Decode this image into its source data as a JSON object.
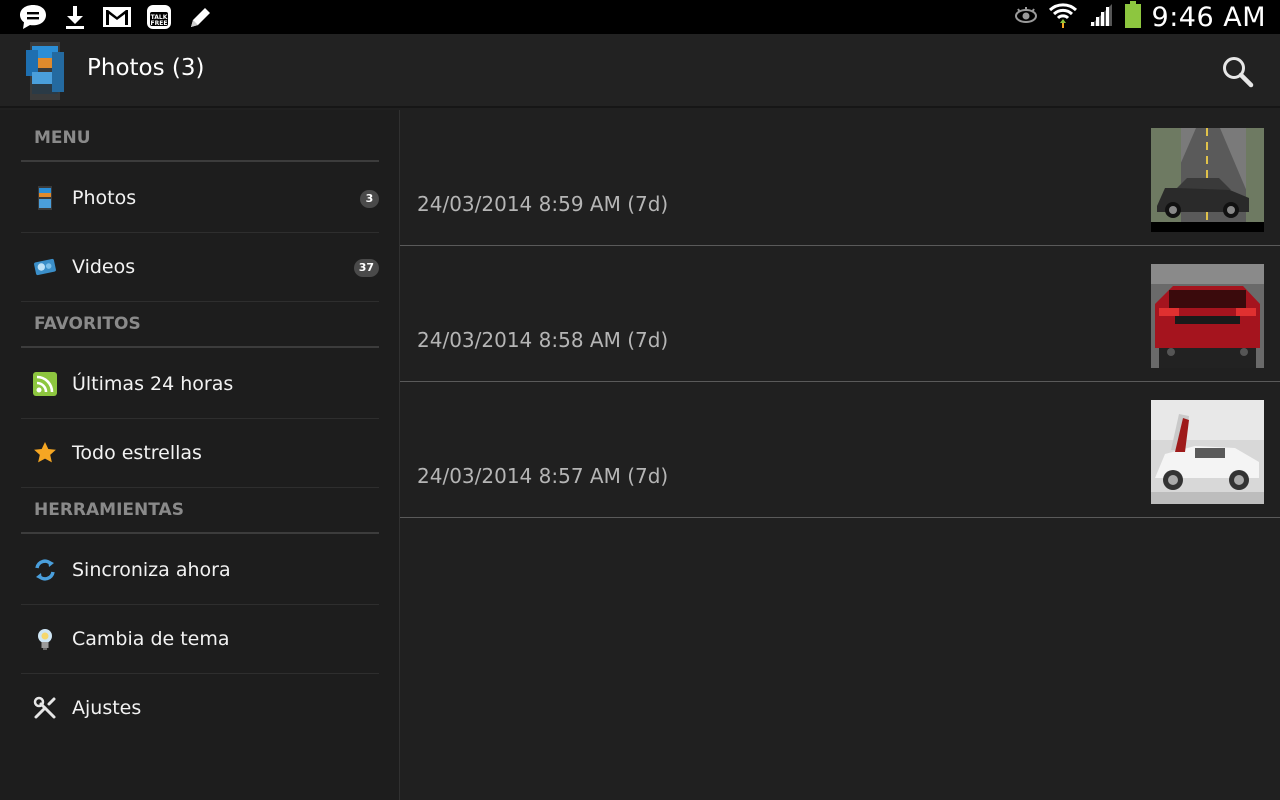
{
  "status_bar": {
    "left_icons": [
      "message-icon",
      "download-icon",
      "gmail-icon",
      "talkfree-icon",
      "pencil-icon"
    ],
    "right_icons": [
      "eye-icon",
      "wifi-icon",
      "signal-icon",
      "battery-icon"
    ],
    "time": "9:46 AM"
  },
  "action_bar": {
    "title": "Photos (3)",
    "search_icon": "search-icon"
  },
  "sidebar": {
    "sections": [
      {
        "header": "MENU",
        "items": [
          {
            "label": "Photos",
            "icon": "photos-icon",
            "badge": "3"
          },
          {
            "label": "Videos",
            "icon": "videos-icon",
            "badge": "37"
          }
        ]
      },
      {
        "header": "FAVORITOS",
        "items": [
          {
            "label": "Últimas 24 horas",
            "icon": "rss-icon"
          },
          {
            "label": "Todo estrellas",
            "icon": "star-icon"
          }
        ]
      },
      {
        "header": "HERRAMIENTAS",
        "items": [
          {
            "label": "Sincroniza ahora",
            "icon": "sync-icon"
          },
          {
            "label": "Cambia de tema",
            "icon": "lightbulb-icon"
          },
          {
            "label": "Ajustes",
            "icon": "tools-icon"
          }
        ]
      }
    ]
  },
  "photos": [
    {
      "date": "24/03/2014 8:59 AM (7d)",
      "thumb": "gray-car-photo"
    },
    {
      "date": "24/03/2014 8:58 AM (7d)",
      "thumb": "red-car-photo"
    },
    {
      "date": "24/03/2014 8:57 AM (7d)",
      "thumb": "white-car-photo"
    }
  ],
  "colors": {
    "background": "#202020",
    "status_bar": "#000000",
    "battery": "#8dc63f",
    "rss": "#8dc63f",
    "star": "#f5a623"
  }
}
